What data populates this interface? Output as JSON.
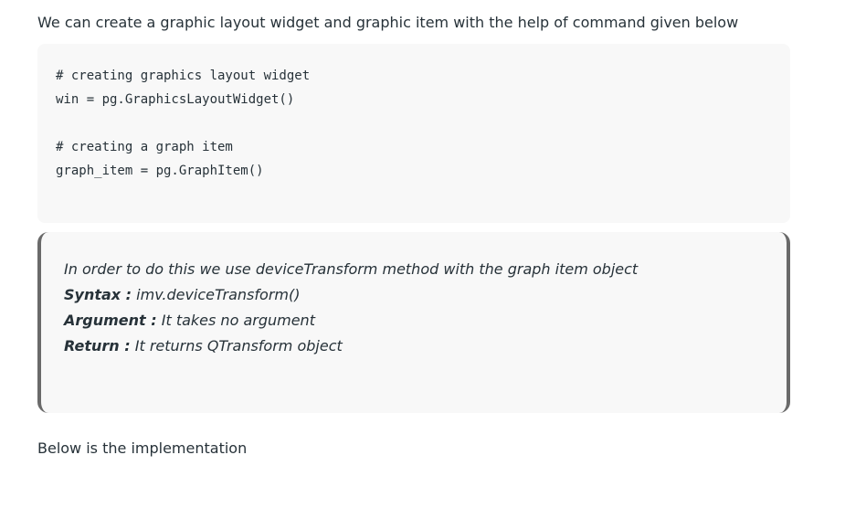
{
  "intro_text": "We can create a graphic layout widget and graphic item with the help of command given below",
  "code": {
    "lines": [
      "# creating graphics layout widget",
      "win = pg.GraphicsLayoutWidget()",
      "",
      "# creating a graph item",
      "graph_item = pg.GraphItem()"
    ]
  },
  "note": {
    "description": "In order to do this we use deviceTransform method with the graph item object",
    "syntax_label": "Syntax :",
    "syntax_value": " imv.deviceTransform()",
    "argument_label": "Argument :",
    "argument_value": " It takes no argument",
    "return_label": "Return :",
    "return_value": " It returns QTransform object"
  },
  "outro_text": "Below is the implementation"
}
